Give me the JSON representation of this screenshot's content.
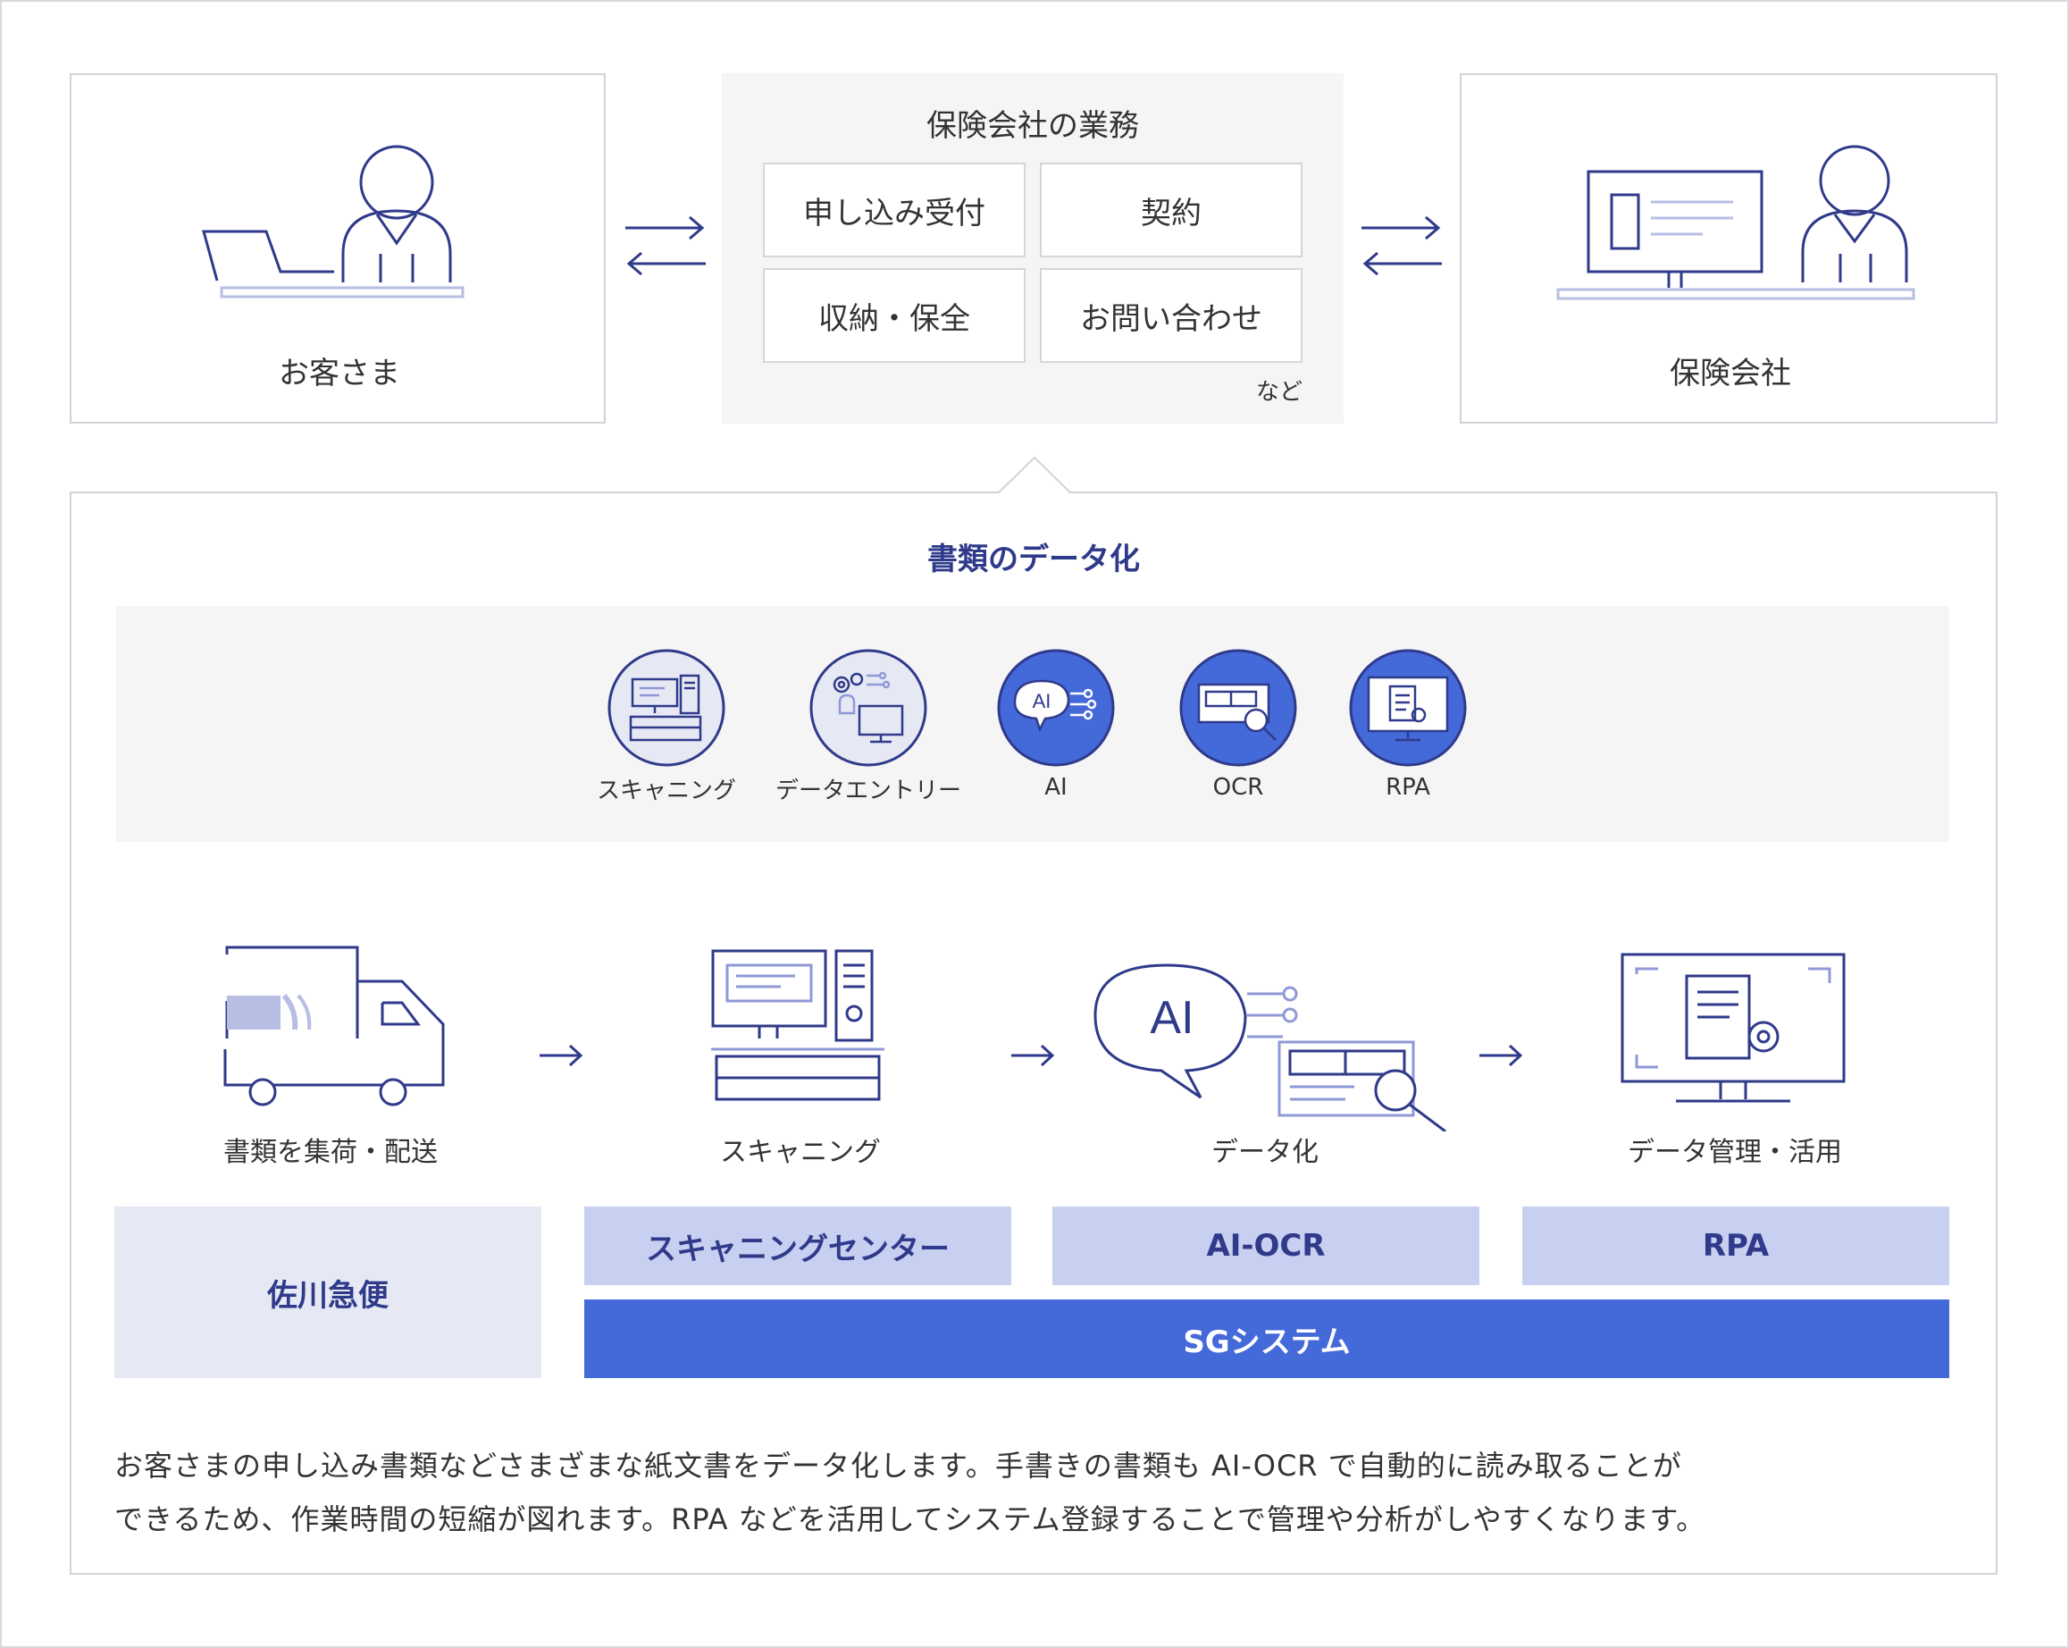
{
  "top": {
    "customer_label": "お客さま",
    "insurer_label": "保険会社",
    "business": {
      "title": "保険会社の業務",
      "tasks": [
        "申し込み受付",
        "契約",
        "収納・保全",
        "お問い合わせ"
      ],
      "note": "など"
    }
  },
  "digitization": {
    "title": "書類のデータ化",
    "tech_icons": [
      {
        "label": "スキャニング",
        "icon": "scanner-icon"
      },
      {
        "label": "データエントリー",
        "icon": "data-entry-icon"
      },
      {
        "label": "AI",
        "icon": "ai-brain-icon",
        "glyph": "AI"
      },
      {
        "label": "OCR",
        "icon": "ocr-icon"
      },
      {
        "label": "RPA",
        "icon": "rpa-icon"
      }
    ]
  },
  "flow": {
    "stages": [
      "書類を集荷・配送",
      "スキャニング",
      "データ化",
      "データ管理・活用"
    ],
    "ai_glyph": "AI"
  },
  "providers": {
    "sagawa": "佐川急便",
    "scanning_center": "スキャニングセンター",
    "ai_ocr": "AI-OCR",
    "rpa": "RPA",
    "sg_system": "SGシステム"
  },
  "description": [
    "お客さまの申し込み書類などさまざまな紙文書をデータ化します。手書きの書類も AI-OCR で自動的に読み取ることが",
    "できるため、作業時間の短縮が図れます。RPA などを活用してシステム登録することで管理や分析がしやすくなります。"
  ],
  "colors": {
    "navy": "#2f3a8a",
    "blue": "#4469d9",
    "light_blue": "#c8d0f1",
    "pale": "#e6e9f4",
    "gray_bg": "#f5f5f6"
  }
}
